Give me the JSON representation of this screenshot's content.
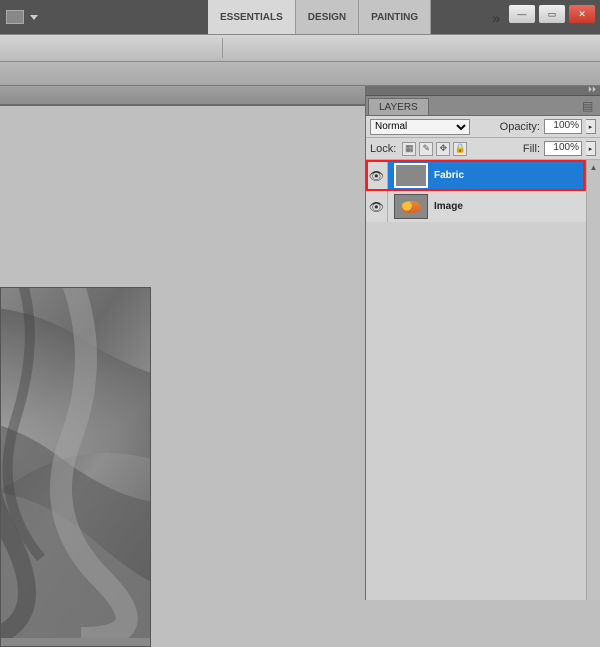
{
  "topbar": {
    "workspaces": [
      "ESSENTIALS",
      "DESIGN",
      "PAINTING"
    ],
    "active_workspace": 0,
    "win_min": "—",
    "win_max": "▭",
    "win_close": "✕"
  },
  "panel": {
    "tab_label": "LAYERS",
    "blend_label": "",
    "blend_modes": [
      "Normal"
    ],
    "blend_selected": "Normal",
    "opacity_label": "Opacity:",
    "opacity_value": "100%",
    "lock_label": "Lock:",
    "fill_label": "Fill:",
    "fill_value": "100%",
    "lock_icons": [
      "pixels-lock-icon",
      "brush-lock-icon",
      "move-lock-icon",
      "all-lock-icon"
    ]
  },
  "layers": [
    {
      "name": "Fabric",
      "visible": true,
      "selected": true,
      "thumb": "fabric"
    },
    {
      "name": "Image",
      "visible": true,
      "selected": false,
      "thumb": "image"
    }
  ],
  "highlight": {
    "layer_index": 0
  }
}
